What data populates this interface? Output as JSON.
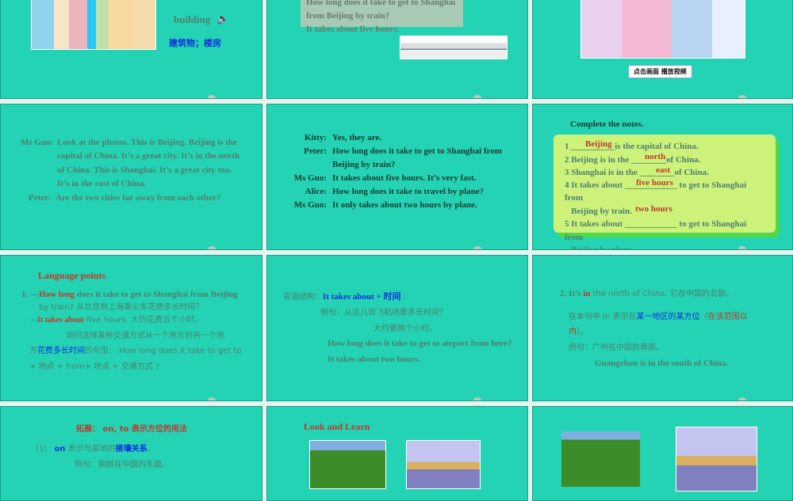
{
  "slide1": {
    "word": "building",
    "meaning": "建筑物；楼房",
    "icon": "speaker-icon"
  },
  "slide2": {
    "lines": [
      "How long does it take to get to Shanghai",
      "from Beijing by train?",
      "It takes about five hours."
    ]
  },
  "slide3": {
    "button": "点击画面  播放视频"
  },
  "slide4": {
    "speakers": [
      "Ms Guo:",
      "Peter:"
    ],
    "lines": [
      "Look at the photos. This is Beijing. Beijing is the",
      "capital of China. It’s a great city. It’s in the north",
      "of China. This is Shanghai. It’s a great city too.",
      "It’s in the east of China.",
      "Are the two cities far away from each other?"
    ]
  },
  "slide5": {
    "rows": [
      {
        "s": "Kitty:",
        "t": "Yes, they are."
      },
      {
        "s": "Peter:",
        "t": "How long does it take to get to Shanghai from"
      },
      {
        "s": "",
        "t": "Beijing by train?"
      },
      {
        "s": "Ms Guo:",
        "t": "It takes about five hours. It’s very fast."
      },
      {
        "s": "Alice:",
        "t": "How long does it take to travel by plane?"
      },
      {
        "s": "Ms Guo:",
        "t": "It only takes about two hours by plane."
      }
    ]
  },
  "slide6": {
    "title": "Complete the notes.",
    "lines": [
      "1  __________is the capital of China.",
      "2  Beijing is in the ________of China.",
      "3  Shanghai is in the ________of China.",
      "4  It takes about ____________ to get to Shanghai",
      "from",
      "   Beijing by train.",
      "5  It takes about ____________ to get to Shanghai",
      "from",
      "   Beijing by plane."
    ],
    "answers": [
      "Beijing",
      "north",
      "east",
      "five hours",
      "two hours"
    ]
  },
  "slide7": {
    "title": "Language points",
    "l1a": "1. —",
    "l1b": "How long",
    "l1c": " does it take to get to Shanghai from Beijing",
    "l2": "by train?  从北京到上海乘火车花费多长时间？",
    "l3a": "—",
    "l3b": "It takes about",
    "l3c": " five hours.  大约花费五个小时。",
    "l4": "询问选择某种交通方式从一个地方到另一个地",
    "l5a": "方",
    "l5b": "花费多长时间",
    "l5c": "的句型：  How long does it take to get to",
    "l6": "+  地点   + from+ 地点   +  交通方式   ?"
  },
  "slide8": {
    "a": "答语结构：",
    "b": "It takes about +  时间",
    "c": " .",
    "l2": "例句：从这儿到飞机场要多长时间？",
    "l3": "大约要两个小时。",
    "l4": "How long does it take to get to airport from here?",
    "l5": "It takes about two hours."
  },
  "slide9": {
    "a": "2. It’s ",
    "b": "in",
    "c": " the north of China.  它在中国的北部。",
    "l2a": "在本句中 in 表示在",
    "l2b": "某一地区的某方位",
    "l2c": "（",
    "l2d": "在该范围以",
    "l3a": "内",
    "l3b": "）。",
    "l4": "例句：广州在中国的南部。",
    "l5": "Guangzhou is in the south of China."
  },
  "slide10": {
    "title": "拓展：  on, to  表示方位的用法",
    "l1a": "（1）  ",
    "l1b": "on",
    "l1c": " 表示与某地的",
    "l1d": "接壤关系",
    "l1e": "。",
    "l2": "例句：朝鲜在中国的东面。"
  },
  "slide11": {
    "title": "Look and Learn"
  }
}
